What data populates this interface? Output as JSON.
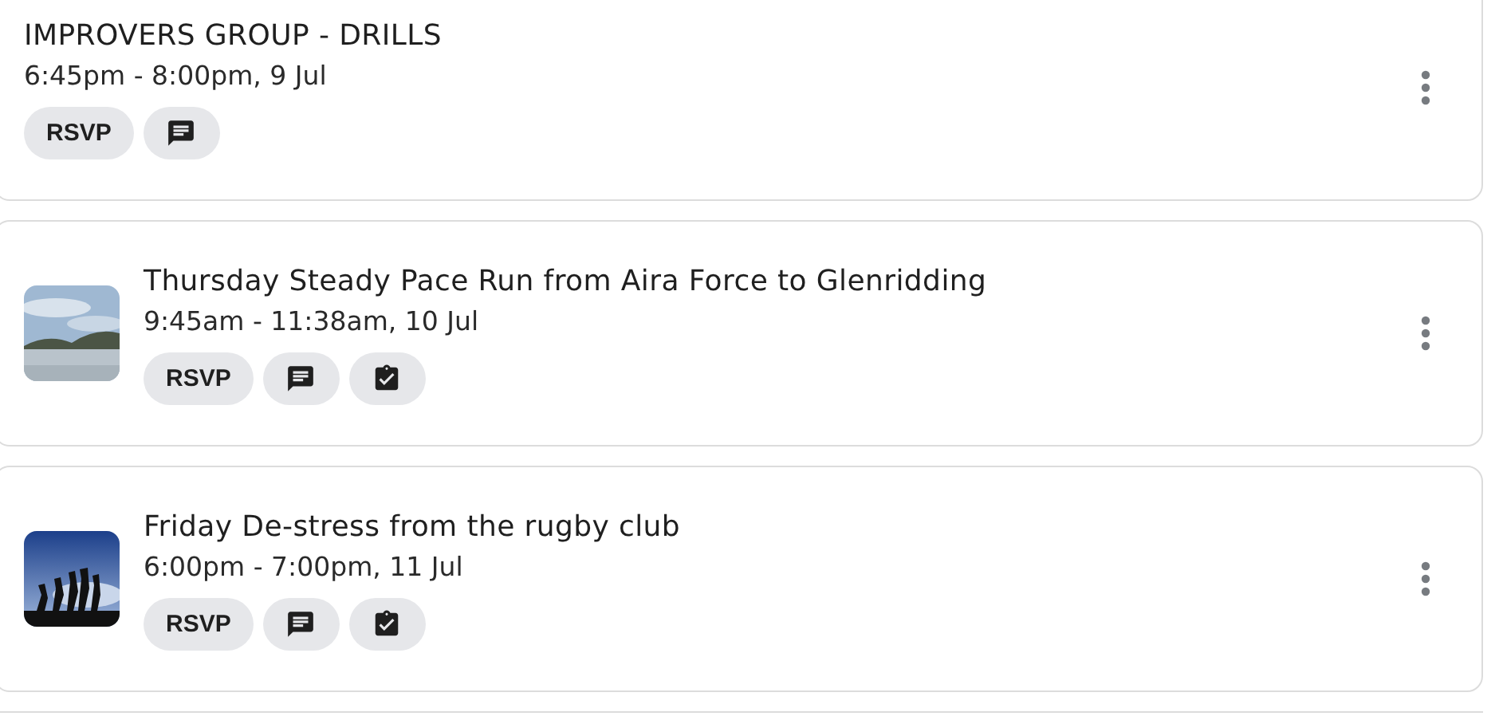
{
  "events": [
    {
      "title": "IMPROVERS GROUP - DRILLS",
      "time": "6:45pm - 8:00pm, 9 Jul",
      "rsvp": "RSVP",
      "actions": [
        {
          "kind": "chat"
        }
      ]
    },
    {
      "title": "Thursday Steady Pace Run from Aira Force to Glenridding",
      "time": "9:45am - 11:38am, 10 Jul",
      "thumbnail": {
        "kind": "picture"
      },
      "rsvp": "RSVP",
      "actions": [
        {
          "kind": "chat"
        },
        {
          "kind": "checklist"
        }
      ]
    },
    {
      "title": "Friday De-stress from the rugby club",
      "time": "6:00pm - 7:00pm, 11 Jul",
      "thumbnail": {
        "kind": "picture"
      },
      "rsvp": "RSVP",
      "actions": [
        {
          "kind": "chat"
        },
        {
          "kind": "checklist"
        }
      ]
    }
  ]
}
